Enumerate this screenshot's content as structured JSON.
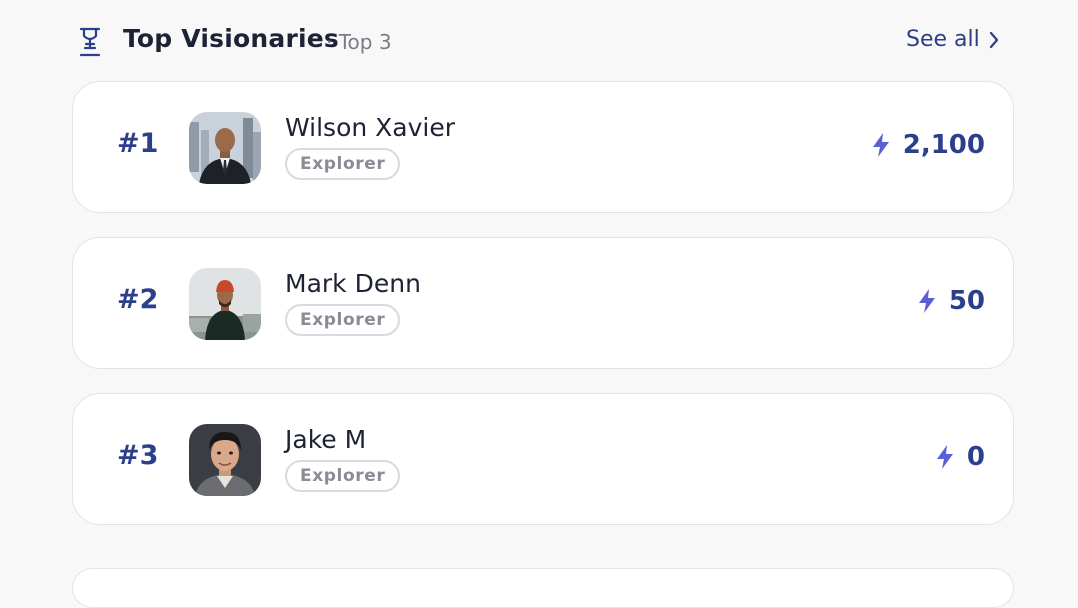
{
  "header": {
    "title": "Top Visionaries",
    "subtitle": "· Top 3",
    "see_all_label": "See all",
    "trophy_icon": "trophy-icon",
    "chevron_icon": "chevron-right-icon"
  },
  "colors": {
    "accent": "#2b3f8b",
    "bolt": "#5a5fd6",
    "badge_text": "#8a8c95"
  },
  "leaderboard": [
    {
      "rank": "#1",
      "name": "Wilson Xavier",
      "badge": "Explorer",
      "score": "2,100"
    },
    {
      "rank": "#2",
      "name": "Mark Denn",
      "badge": "Explorer",
      "score": "50"
    },
    {
      "rank": "#3",
      "name": "Jake M",
      "badge": "Explorer",
      "score": "0"
    }
  ]
}
